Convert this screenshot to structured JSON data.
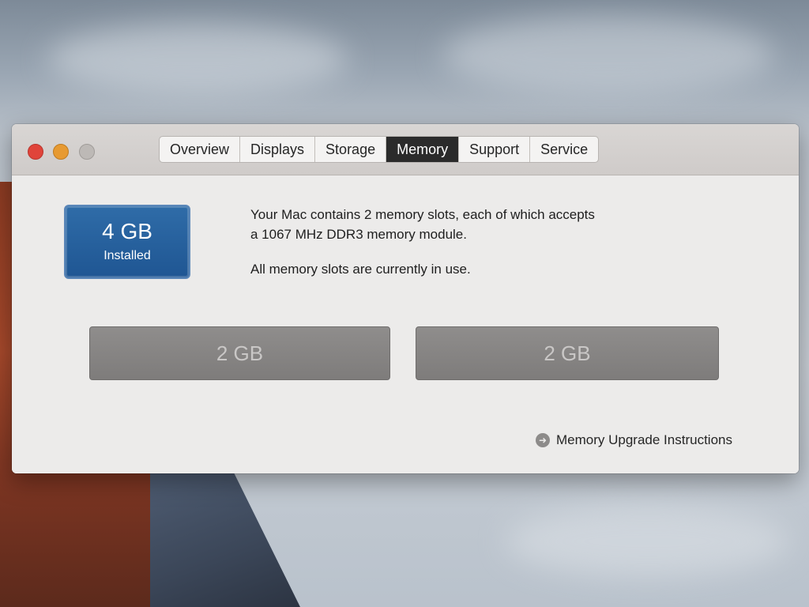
{
  "window": {
    "tabs": [
      {
        "label": "Overview"
      },
      {
        "label": "Displays"
      },
      {
        "label": "Storage"
      },
      {
        "label": "Memory",
        "active": true
      },
      {
        "label": "Support"
      },
      {
        "label": "Service"
      }
    ]
  },
  "memory": {
    "installed_amount": "4 GB",
    "installed_label": "Installed",
    "description_line1": "Your Mac contains 2 memory slots, each of which accepts",
    "description_line2": "a 1067 MHz DDR3 memory module.",
    "status": "All memory slots are currently in use.",
    "slots": [
      {
        "label": "2 GB"
      },
      {
        "label": "2 GB"
      }
    ],
    "upgrade_link": "Memory Upgrade Instructions",
    "upgrade_icon": "arrow-circle-icon"
  },
  "colors": {
    "active_tab": "#2b2b2b",
    "installed_box": "#2f6ca8",
    "slot": "#8f8d8c",
    "close_light": "#e0443a",
    "minimize_light": "#e79a32",
    "zoom_light": "#bdb9b6"
  }
}
